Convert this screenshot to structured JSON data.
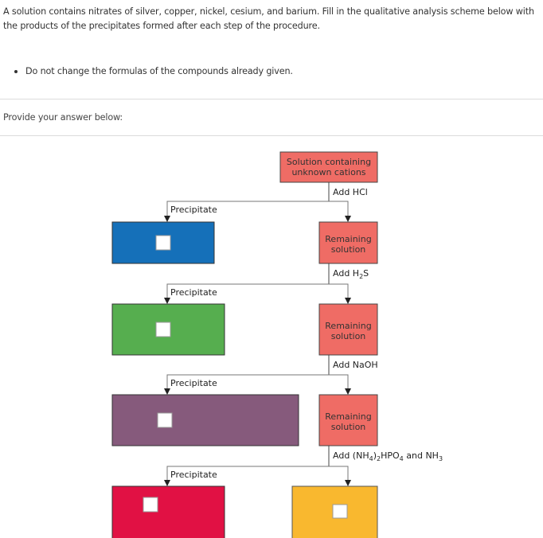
{
  "question": {
    "text": "A solution contains nitrates of silver, copper, nickel, cesium, and barium. Fill in the qualitative analysis scheme below with the products of the precipitates formed after each step of the procedure.",
    "instructions": [
      "Do not change the formulas of the compounds already given."
    ],
    "prompt": "Provide your answer below:"
  },
  "scheme": {
    "start_box": {
      "line1": "Solution containing",
      "line2": "unknown cations",
      "color": "#ef6c65"
    },
    "steps": [
      {
        "reagent_parts": [
          {
            "t": "Add HCl"
          }
        ]
      },
      {
        "reagent_parts": [
          {
            "t": "Add H"
          },
          {
            "t": "2",
            "sub": true
          },
          {
            "t": "S"
          }
        ]
      },
      {
        "reagent_parts": [
          {
            "t": "Add NaOH"
          }
        ]
      },
      {
        "reagent_parts": [
          {
            "t": "Add (NH"
          },
          {
            "t": "4",
            "sub": true
          },
          {
            "t": ")"
          },
          {
            "t": "2",
            "sub": true
          },
          {
            "t": "HPO"
          },
          {
            "t": "4",
            "sub": true
          },
          {
            "t": " and NH"
          },
          {
            "t": "3",
            "sub": true
          }
        ]
      }
    ],
    "precipitate_label": "Precipitate",
    "remaining_label": {
      "line1": "Remaining",
      "line2": "solution"
    },
    "remaining_color": "#ef6c65",
    "precipitate_colors": [
      "#1570b9",
      "#56ae4f",
      "#865a7c",
      "#e11144"
    ],
    "final_solution_color": "#f9b82f",
    "answer_fields": [
      "",
      "",
      "",
      "",
      ""
    ]
  }
}
